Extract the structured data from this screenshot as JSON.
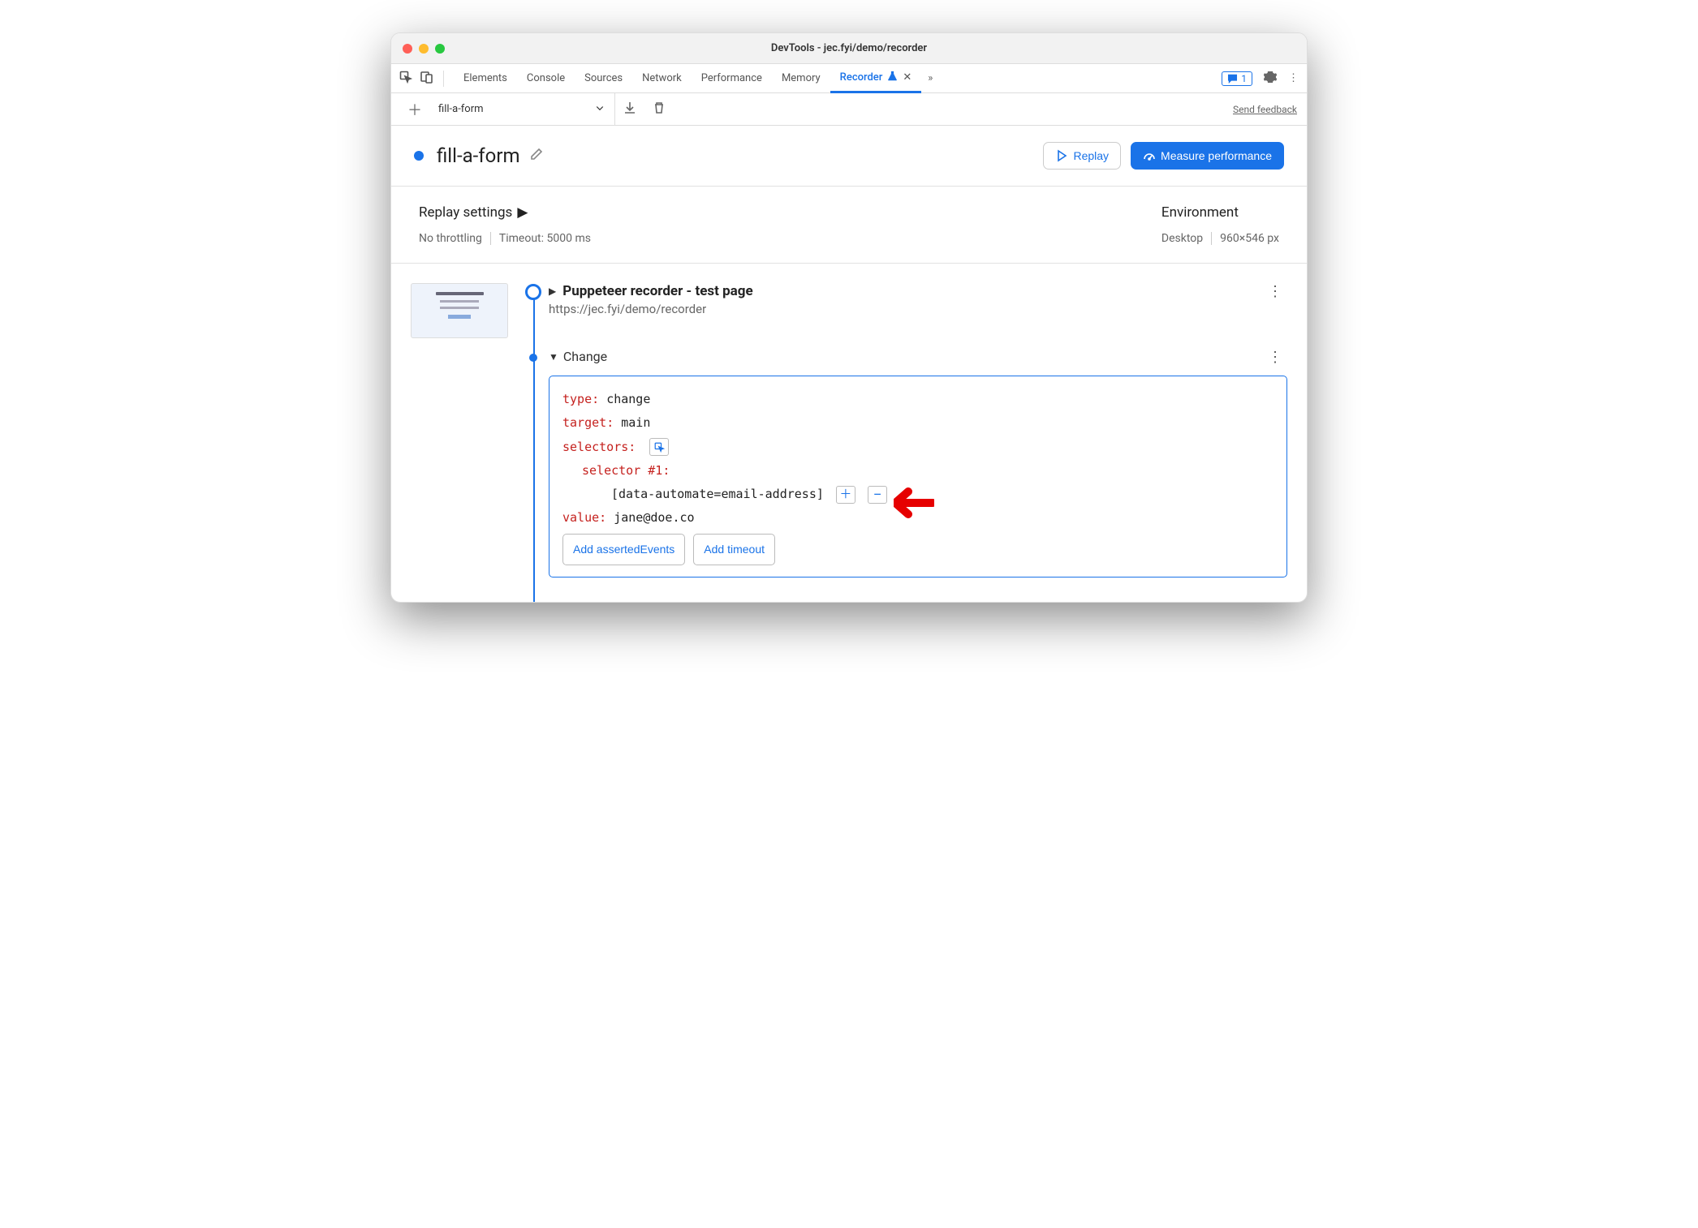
{
  "window": {
    "title": "DevTools - jec.fyi/demo/recorder"
  },
  "tabs": {
    "items": [
      "Elements",
      "Console",
      "Sources",
      "Network",
      "Performance",
      "Memory",
      "Recorder"
    ],
    "active": "Recorder",
    "badge_count": "1"
  },
  "toolbar": {
    "recording_name": "fill-a-form",
    "feedback": "Send feedback"
  },
  "header": {
    "title": "fill-a-form",
    "replay_label": "Replay",
    "measure_label": "Measure performance"
  },
  "settings": {
    "replay_heading": "Replay settings",
    "throttling": "No throttling",
    "timeout": "Timeout: 5000 ms",
    "env_heading": "Environment",
    "device": "Desktop",
    "viewport": "960×546 px"
  },
  "steps": {
    "start": {
      "title": "Puppeteer recorder - test page",
      "url": "https://jec.fyi/demo/recorder"
    },
    "change": {
      "label": "Change",
      "type_key": "type",
      "type_val": "change",
      "target_key": "target",
      "target_val": "main",
      "selectors_key": "selectors",
      "selector_num": "selector #1",
      "selector_val": "[data-automate=email-address]",
      "value_key": "value",
      "value_val": "jane@doe.co",
      "add_asserted": "Add assertedEvents",
      "add_timeout": "Add timeout"
    }
  }
}
